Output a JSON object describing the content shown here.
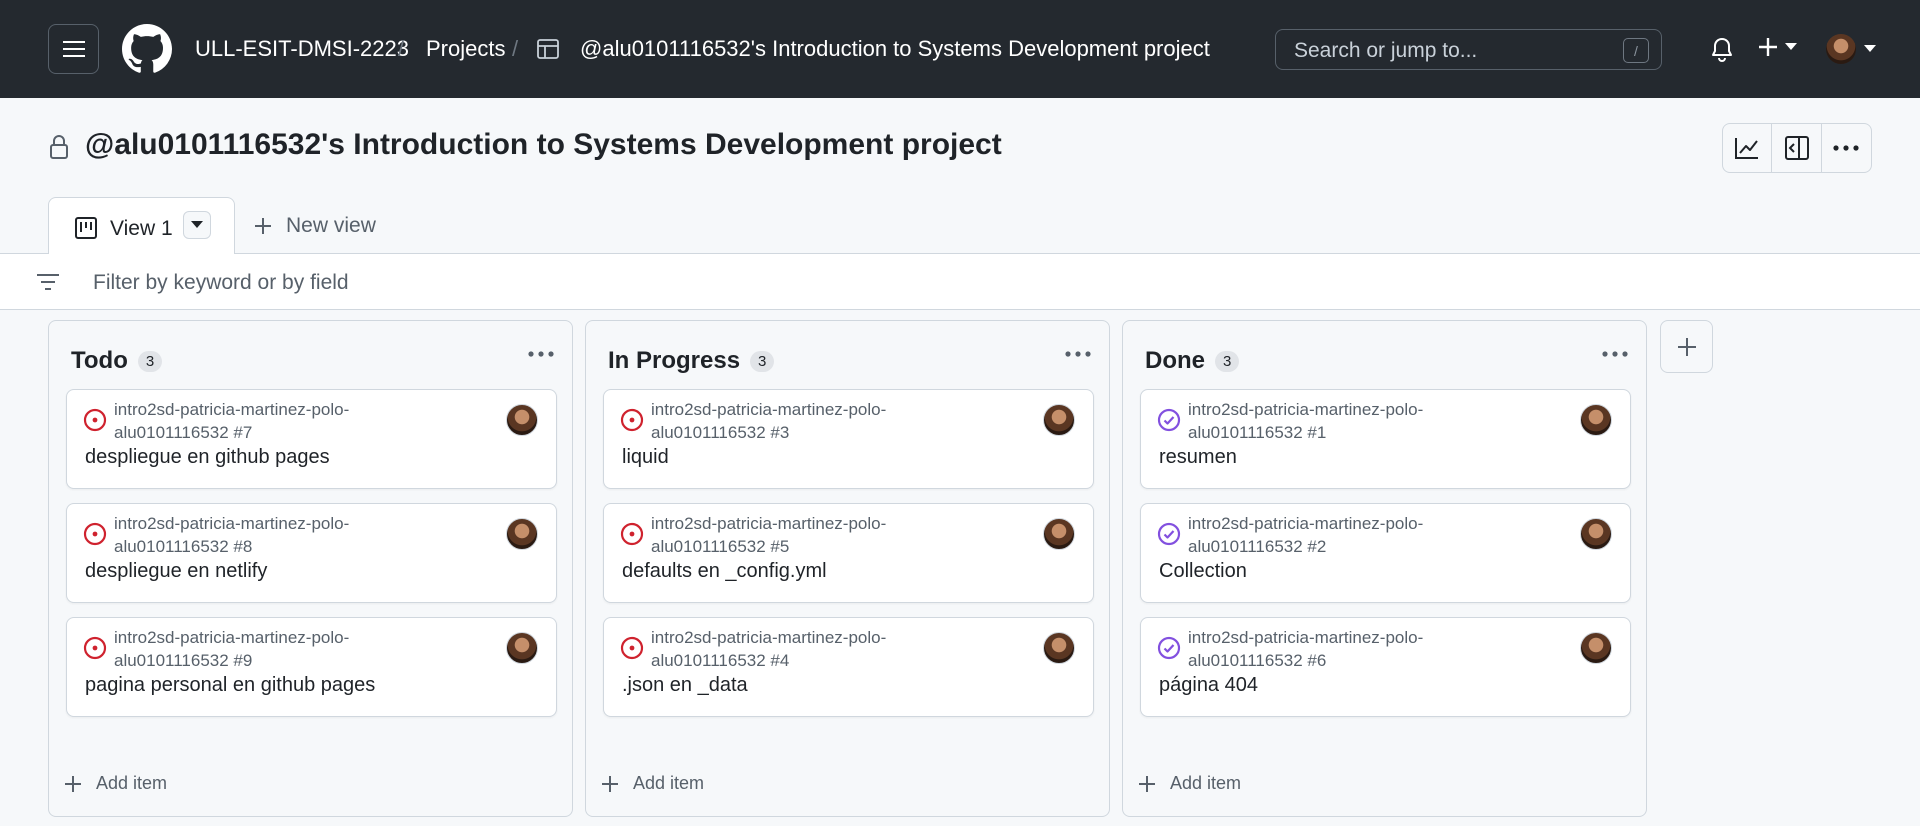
{
  "header": {
    "org": "ULL-ESIT-DMSI-2223",
    "projects": "Projects",
    "project_crumb": "@alu0101116532's Introduction to Systems Development project",
    "separator": "/",
    "search_placeholder": "Search or jump to...",
    "search_key": "/"
  },
  "project": {
    "title": "@alu0101116532's Introduction to Systems Development project"
  },
  "tabs": {
    "active_label": "View 1",
    "new_view_label": "New view"
  },
  "filter": {
    "placeholder": "Filter by keyword or by field"
  },
  "columns": [
    {
      "title": "Todo",
      "count": "3",
      "status": "open",
      "add_item": "Add item",
      "cards": [
        {
          "repo": "intro2sd-patricia-martinez-polo-",
          "ref": "alu0101116532 #7",
          "title": "despliegue en github pages"
        },
        {
          "repo": "intro2sd-patricia-martinez-polo-",
          "ref": "alu0101116532 #8",
          "title": "despliegue en netlify"
        },
        {
          "repo": "intro2sd-patricia-martinez-polo-",
          "ref": "alu0101116532 #9",
          "title": "pagina personal en github pages"
        }
      ]
    },
    {
      "title": "In Progress",
      "count": "3",
      "status": "open",
      "add_item": "Add item",
      "cards": [
        {
          "repo": "intro2sd-patricia-martinez-polo-",
          "ref": "alu0101116532 #3",
          "title": "liquid"
        },
        {
          "repo": "intro2sd-patricia-martinez-polo-",
          "ref": "alu0101116532 #5",
          "title": "defaults en _config.yml"
        },
        {
          "repo": "intro2sd-patricia-martinez-polo-",
          "ref": "alu0101116532 #4",
          "title": ".json en _data"
        }
      ]
    },
    {
      "title": "Done",
      "count": "3",
      "status": "closed",
      "add_item": "Add item",
      "cards": [
        {
          "repo": "intro2sd-patricia-martinez-polo-",
          "ref": "alu0101116532 #1",
          "title": "resumen"
        },
        {
          "repo": "intro2sd-patricia-martinez-polo-",
          "ref": "alu0101116532 #2",
          "title": "Collection"
        },
        {
          "repo": "intro2sd-patricia-martinez-polo-",
          "ref": "alu0101116532 #6",
          "title": "página 404"
        }
      ]
    }
  ],
  "colors": {
    "header_bg": "#24292f",
    "open_issue": "#cf222e",
    "closed_issue": "#8250df"
  },
  "icons": {
    "menu": "hamburger-icon",
    "logo": "github-logo-icon",
    "table": "table-icon",
    "bell": "bell-icon",
    "plus": "plus-icon",
    "lock": "lock-icon",
    "insights": "graph-icon",
    "sidepanel": "sidepanel-icon",
    "more": "kebab-horizontal-icon",
    "board": "project-board-icon",
    "filter": "filter-icon",
    "open": "issue-open-icon",
    "closed": "issue-closed-icon"
  }
}
